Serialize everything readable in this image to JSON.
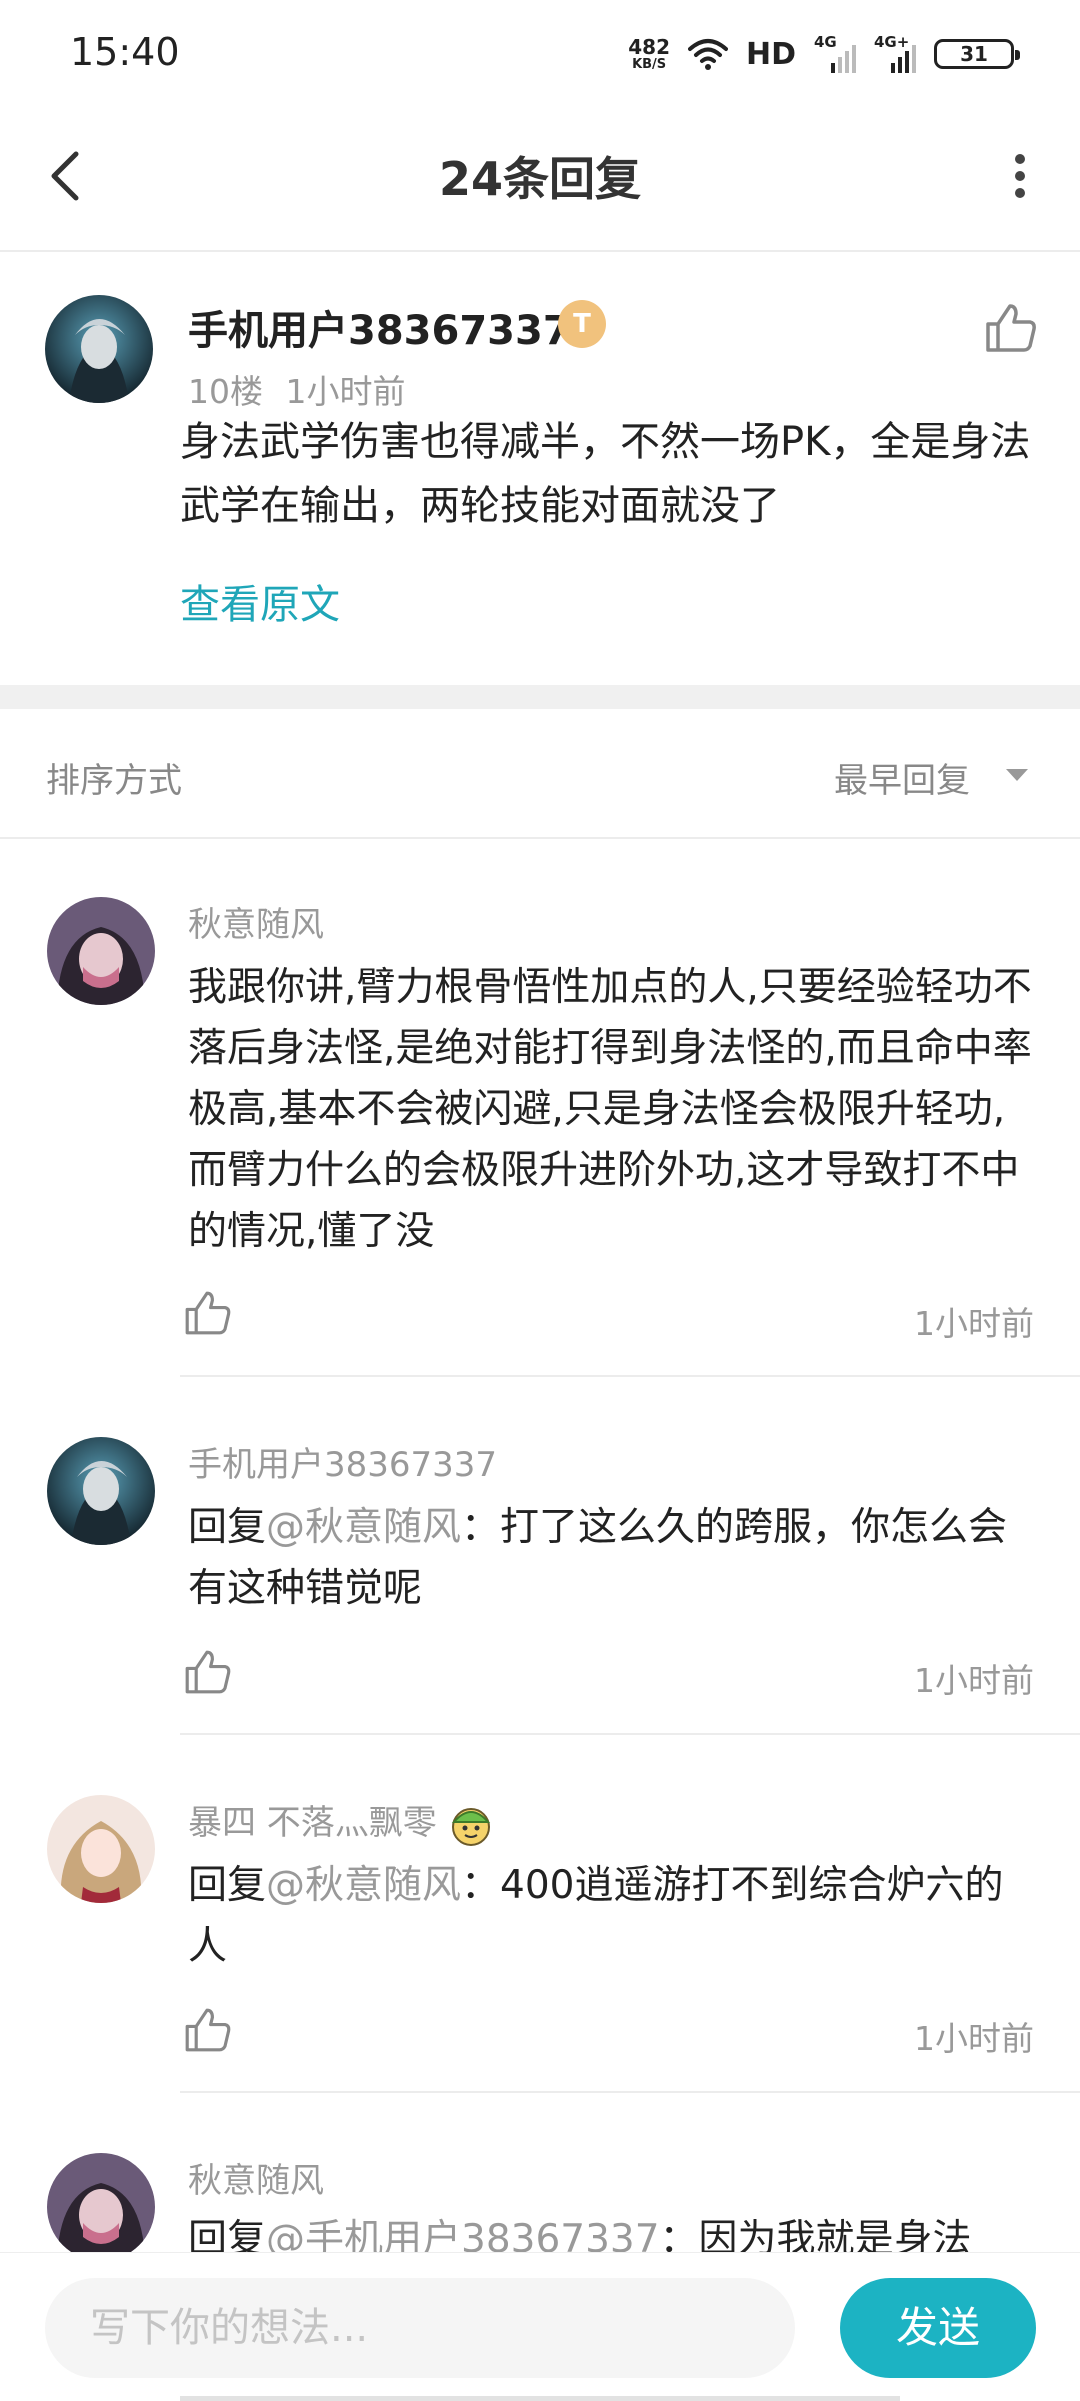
{
  "status_bar": {
    "time": "15:40",
    "net_speed_value": "482",
    "net_speed_unit": "KB/S",
    "hd_label": "HD",
    "sim1_label": "4G",
    "sim2_label": "4G+",
    "battery": "31"
  },
  "header": {
    "title": "24条回复"
  },
  "main_comment": {
    "user": "手机用户38367337",
    "badge": "T",
    "floor": "10楼",
    "time": "1小时前",
    "text": "身法武学伤害也得减半，不然一场PK，全是身法武学在输出，两轮技能对面就没了",
    "view_original": "查看原文"
  },
  "sort": {
    "label": "排序方式",
    "value": "最早回复"
  },
  "replies": [
    {
      "user": "秋意随风",
      "text": "我跟你讲,臂力根骨悟性加点的人,只要经验轻功不落后身法怪,是绝对能打得到身法怪的,而且命中率极高,基本不会被闪避,只是身法怪会极限升轻功,而臂力什么的会极限升进阶外功,这才导致打不中的情况,懂了没",
      "time": "1小时前"
    },
    {
      "user": "手机用户38367337",
      "reply_prefix": "回复",
      "mention": "@秋意随风",
      "text": "：打了这么久的跨服，你怎么会有这种错觉呢",
      "time": "1小时前"
    },
    {
      "user": "暴四 不落灬飘零",
      "reply_prefix": "回复",
      "mention": "@秋意随风",
      "text": "：400逍遥游打不到综合炉六的人",
      "time": "1小时前"
    },
    {
      "user": "秋意随风",
      "reply_prefix": "回复",
      "mention": "@手机用户38367337",
      "text": "：因为我就是身法"
    }
  ],
  "composer": {
    "placeholder": "写下你的想法...",
    "send_label": "发送"
  },
  "colors": {
    "accent": "#1cb3c3",
    "link": "#1fa6b8",
    "muted": "#999999"
  }
}
